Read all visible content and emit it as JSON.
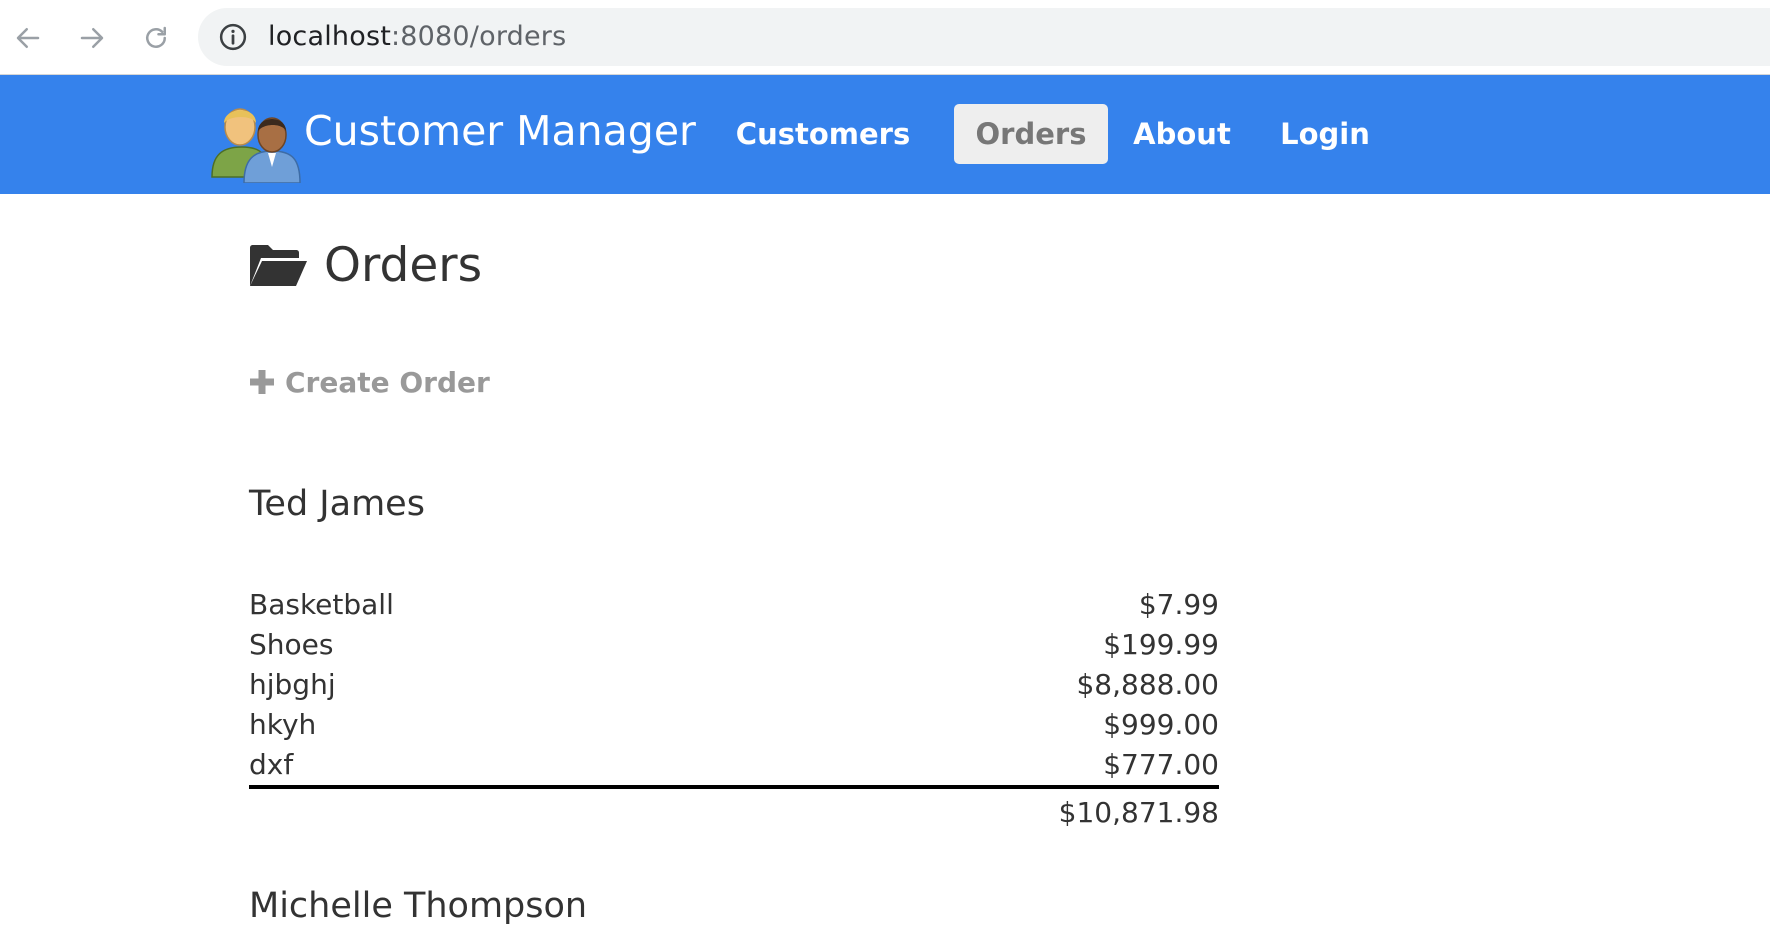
{
  "browser": {
    "url_host": "localhost",
    "url_path": ":8080/orders"
  },
  "navbar": {
    "brand": "Customer Manager",
    "items": [
      {
        "label": "Customers",
        "active": false
      },
      {
        "label": "Orders",
        "active": true
      },
      {
        "label": "About",
        "active": false
      },
      {
        "label": "Login",
        "active": false
      }
    ]
  },
  "page": {
    "title": "Orders",
    "create_label": "Create Order"
  },
  "customers": [
    {
      "name": "Ted James",
      "orders": [
        {
          "product": "Basketball",
          "amount": "$7.99"
        },
        {
          "product": "Shoes",
          "amount": "$199.99"
        },
        {
          "product": "hjbghj",
          "amount": "$8,888.00"
        },
        {
          "product": "hkyh",
          "amount": "$999.00"
        },
        {
          "product": "dxf",
          "amount": "$777.00"
        }
      ],
      "total": "$10,871.98"
    },
    {
      "name": "Michelle Thompson"
    }
  ],
  "colors": {
    "navbar": "#3582ec",
    "active_tab_bg": "#eeeeee",
    "active_tab_text": "#777777",
    "link_muted": "#999999",
    "text": "#333333"
  },
  "icons": {
    "back": "arrow-left-icon",
    "forward": "arrow-right-icon",
    "reload": "reload-icon",
    "site_info": "info-icon",
    "logo": "people-logo",
    "title": "folder-open-icon",
    "create": "plus-icon"
  }
}
